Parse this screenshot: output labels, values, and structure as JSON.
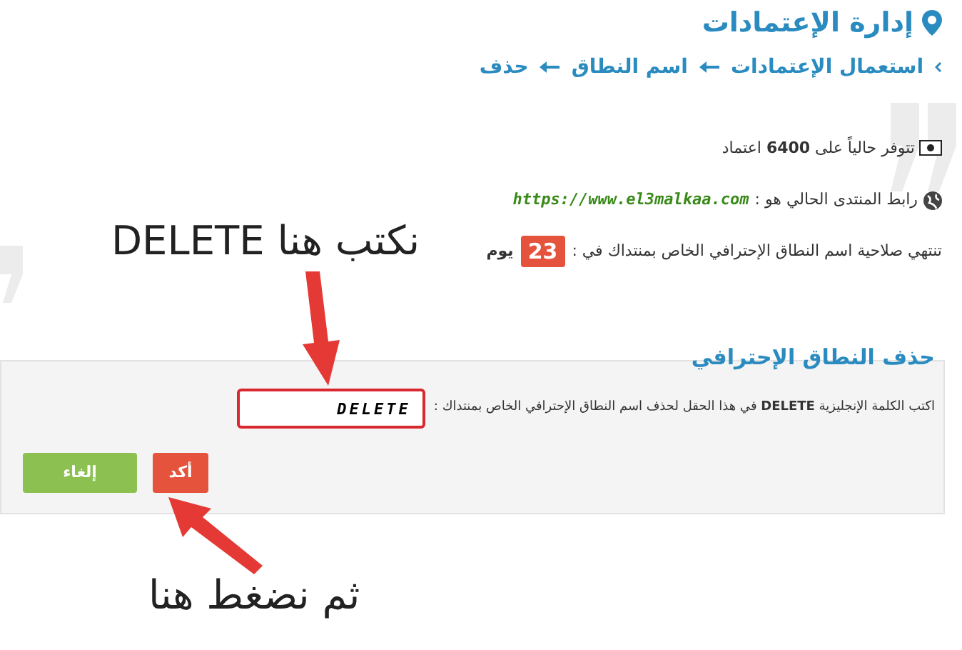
{
  "header": {
    "title": "إدارة الإعتمادات"
  },
  "breadcrumb": [
    "استعمال الإعتمادات",
    "اسم النطاق",
    "حذف"
  ],
  "info": {
    "credits": "تتوفر حالياً على **6400** اعتماد",
    "link_label": "رابط المنتدى الحالي هو :",
    "link_url": "https://www.el3malkaa.com",
    "expiry_label": "تنتهي صلاحية اسم النطاق الإحترافي الخاص بمنتداك في :",
    "days": "23",
    "days_unit": "يوم"
  },
  "panel": {
    "title": "حذف النطاق الإحترافي",
    "instruction": "اكتب الكلمة الإنجليزية **DELETE** في هذا الحقل لحذف اسم النطاق الإحترافي الخاص بمنتداك :",
    "value": "DELETE",
    "confirm": "أكد",
    "cancel": "إلغاء"
  },
  "annotations": [
    "نكتب هنا DELETE",
    "ثم نضغط هنا"
  ]
}
